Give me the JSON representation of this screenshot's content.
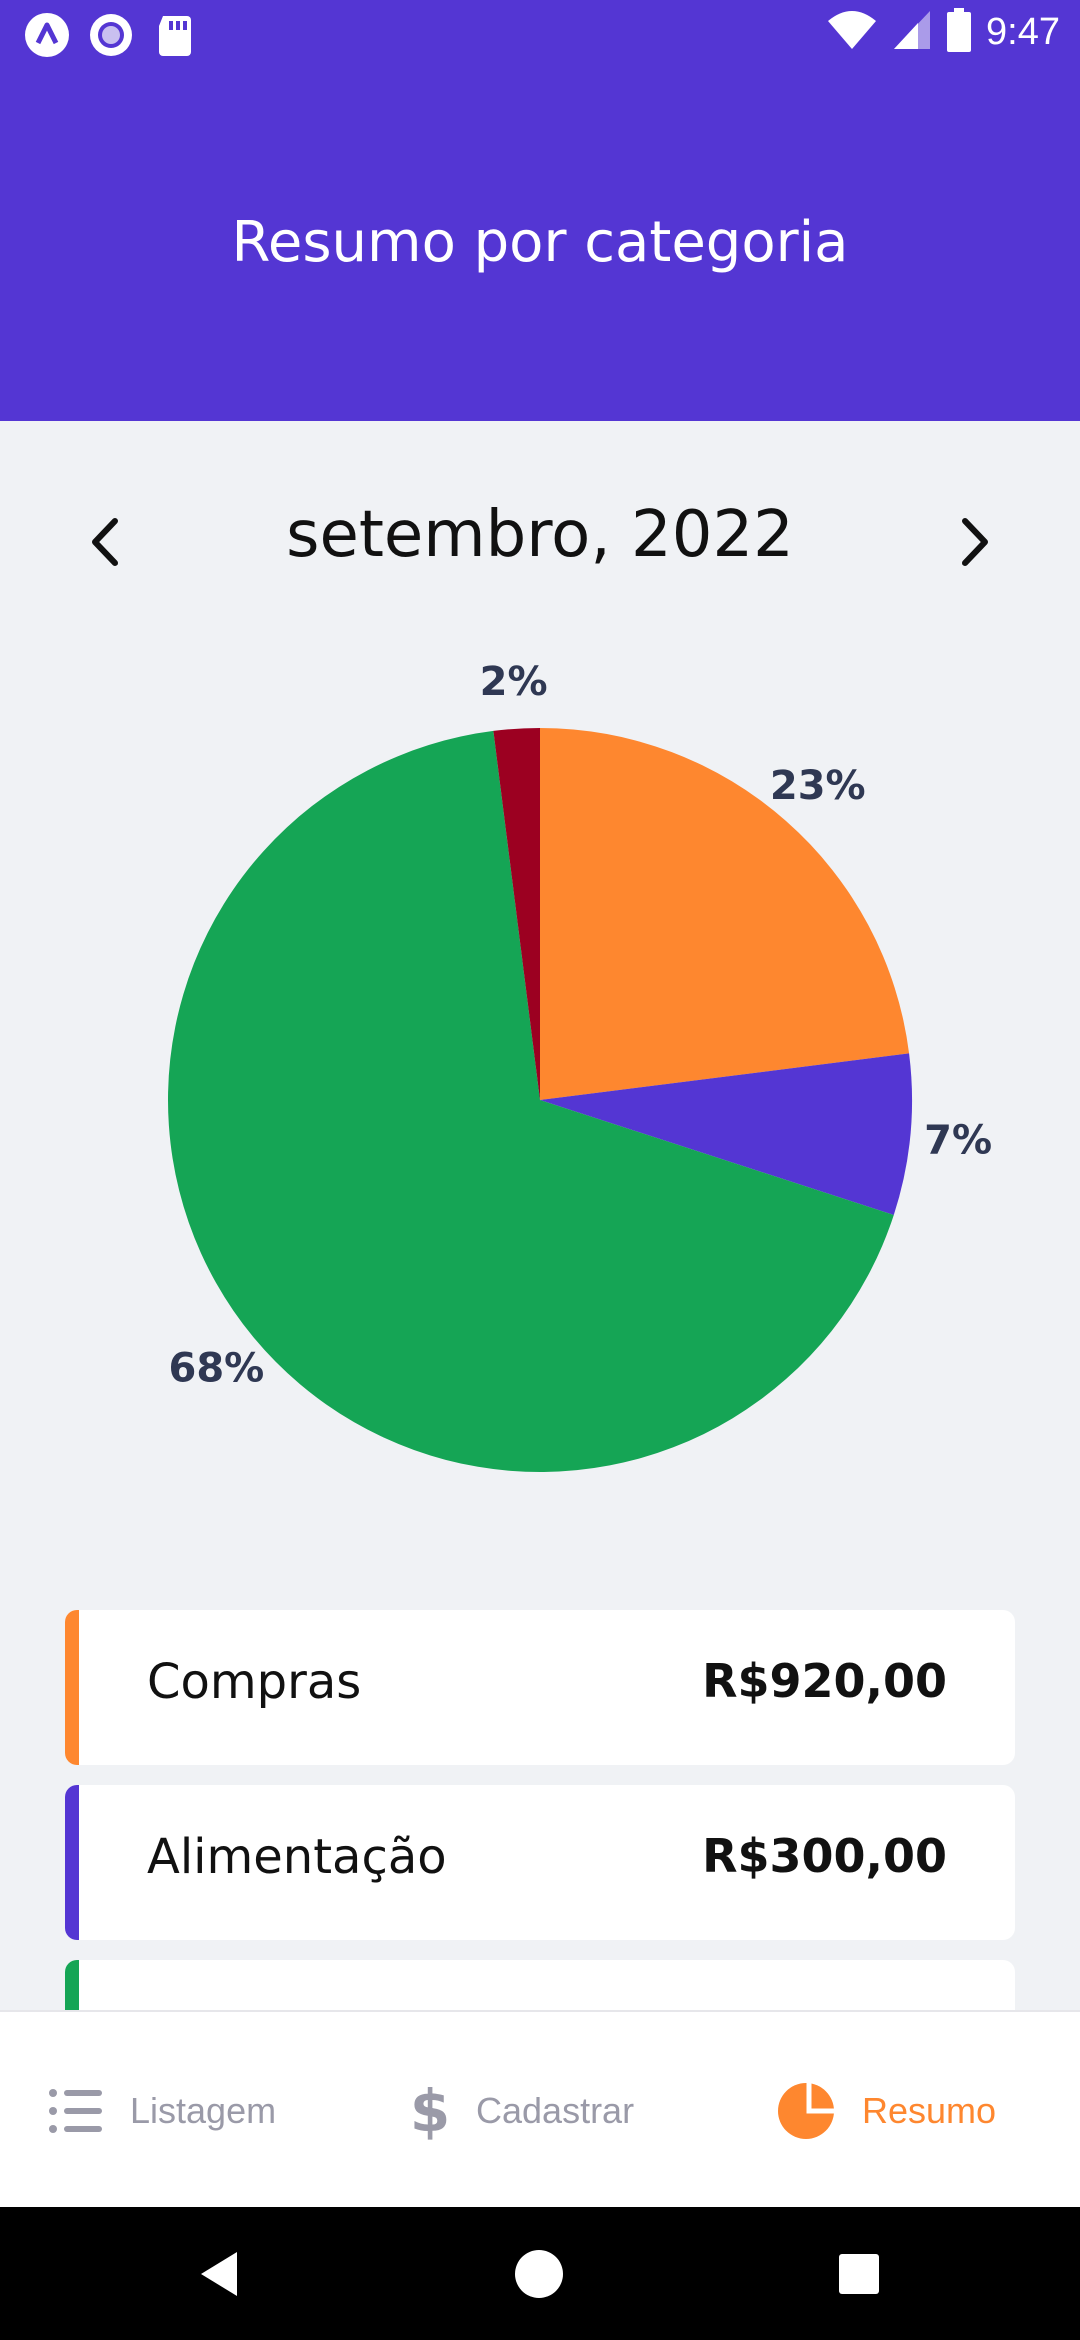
{
  "status_bar": {
    "time": "9:47",
    "left_icons": [
      "app-logo-icon",
      "record-icon",
      "sd-card-icon"
    ],
    "right_icons": [
      "wifi-icon",
      "cellular-icon",
      "battery-icon"
    ]
  },
  "app_bar": {
    "title": "Resumo por categoria",
    "color": "#5436d3"
  },
  "month_selector": {
    "label": "setembro, 2022",
    "prev_icon": "chevron-left-icon",
    "next_icon": "chevron-right-icon"
  },
  "chart_data": {
    "type": "pie",
    "title": "",
    "slices": [
      {
        "label": "Compras",
        "value": 23,
        "display": "23%",
        "color": "#fe872f"
      },
      {
        "label": "Alimentação",
        "value": 7,
        "display": "7%",
        "color": "#5436d3"
      },
      {
        "label": "",
        "value": 68,
        "display": "68%",
        "color": "#15a555"
      },
      {
        "label": "",
        "value": 2,
        "display": "2%",
        "color": "#9c0021"
      }
    ]
  },
  "categories": [
    {
      "name": "Compras",
      "value": "R$920,00",
      "color": "#fe872f"
    },
    {
      "name": "Alimentação",
      "value": "R$300,00",
      "color": "#5436d3"
    },
    {
      "name": "",
      "value": "",
      "color": "#15a555"
    }
  ],
  "bottom_nav": {
    "items": [
      {
        "label": "Listagem",
        "icon": "list-icon",
        "active": false
      },
      {
        "label": "Cadastrar",
        "icon": "dollar-icon",
        "active": false
      },
      {
        "label": "Resumo",
        "icon": "pie-chart-icon",
        "active": true
      }
    ],
    "active_color": "#fe872f",
    "inactive_color": "#9a9aa8"
  },
  "system_nav": {
    "icons": [
      "back-icon",
      "home-icon",
      "recents-icon"
    ]
  }
}
